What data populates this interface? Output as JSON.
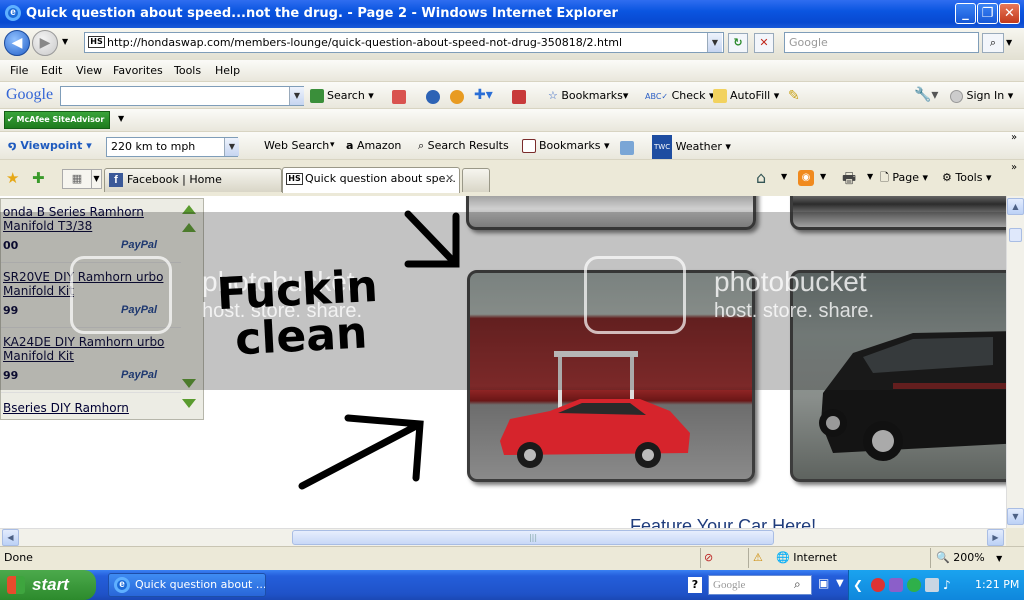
{
  "window": {
    "title": "Quick question about speed...not the drug. - Page 2 - Windows Internet Explorer"
  },
  "address": {
    "url": "http://hondaswap.com/members-lounge/quick-question-about-speed-not-drug-350818/2.html",
    "search_placeholder": "Google"
  },
  "menu": [
    "File",
    "Edit",
    "View",
    "Favorites",
    "Tools",
    "Help"
  ],
  "google_bar": {
    "logo": "Google",
    "search": "Search",
    "bookmarks": "Bookmarks",
    "check": "Check",
    "autofill": "AutoFill",
    "sign_in": "Sign In"
  },
  "mcafee": {
    "label": "McAfee SiteAdvisor"
  },
  "viewpoint_bar": {
    "logo": "Viewpoint",
    "field_value": "220 km to mph",
    "web_search": "Web Search",
    "amazon": "Amazon",
    "search_results": "Search Results",
    "bookmarks": "Bookmarks",
    "weather_badge": "TWC",
    "weather": "Weather"
  },
  "tabs": [
    {
      "label": "Facebook | Home"
    },
    {
      "label": "Quick question about spe..."
    }
  ],
  "command_bar": {
    "page": "Page",
    "tools": "Tools"
  },
  "sidebar": {
    "items": [
      {
        "title": "onda B Series Ramhorn Manifold T3/38",
        "price": "00"
      },
      {
        "title": "SR20VE DIY Ramhorn urbo Manifold Kit",
        "price": "99"
      },
      {
        "title": "KA24DE DIY Ramhorn urbo Manifold Kit",
        "price": "99"
      },
      {
        "title": "Bseries DIY Ramhorn",
        "price": ""
      }
    ],
    "paypal": "PayPal"
  },
  "scribble": {
    "line1": "Fuckin",
    "line2": "clean"
  },
  "watermark": {
    "brand": "photobucket",
    "tagline": "host. store. share."
  },
  "feature_text": "Feature Your Car Here!",
  "status": {
    "text": "Done",
    "zone": "Internet",
    "zoom": "200%"
  },
  "taskbar": {
    "start": "start",
    "window_button": "Quick question about ...",
    "tray_search": "Google",
    "clock": "1:21 PM"
  }
}
